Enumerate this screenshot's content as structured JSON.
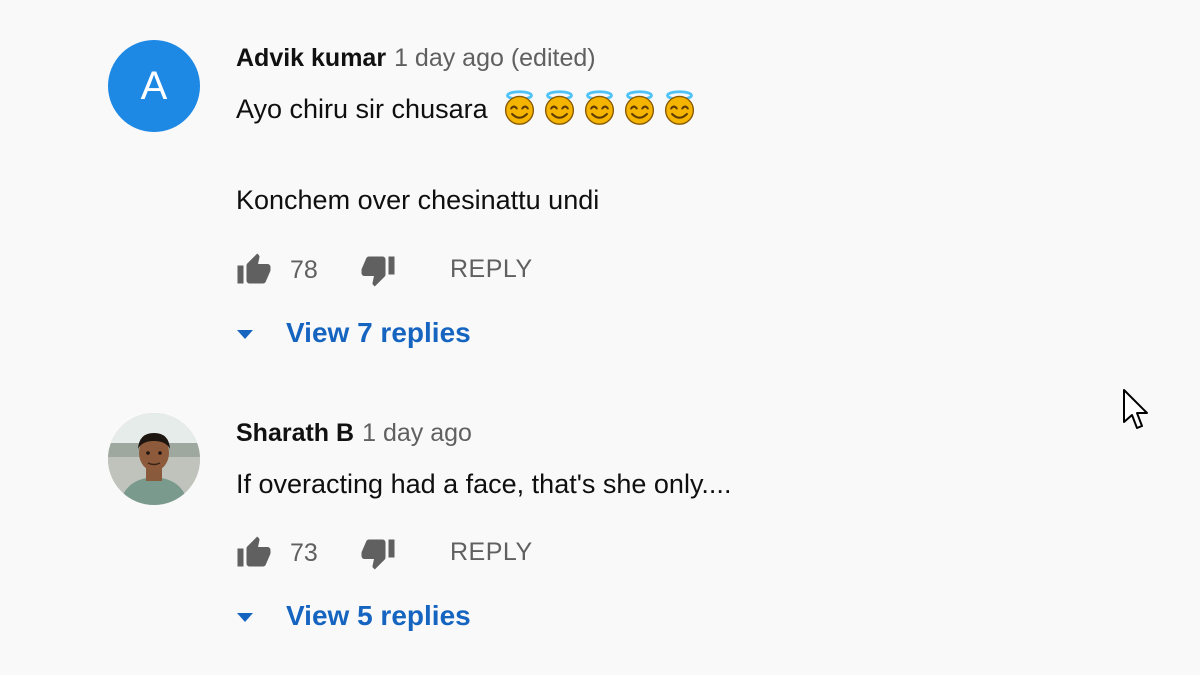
{
  "comments": [
    {
      "author": "Advik kumar",
      "meta": "1 day ago (edited)",
      "avatar_letter": "A",
      "avatar_color": "#1e88e5",
      "text_line1": "Ayo chiru sir chusara",
      "emojis": [
        "smiling-face-with-halo",
        "smiling-face-with-halo",
        "smiling-face-with-halo",
        "smiling-face-with-halo",
        "smiling-face-with-halo"
      ],
      "text_line2": "Konchem over chesinattu undi",
      "likes": "78",
      "reply_label": "REPLY",
      "view_replies": "View 7 replies"
    },
    {
      "author": "Sharath B",
      "meta": "1 day ago",
      "avatar_photo": "profile-photo",
      "text_line1": "If overacting had a face, that's she only....",
      "likes": "73",
      "reply_label": "REPLY",
      "view_replies": "View 5 replies"
    }
  ],
  "colors": {
    "background": "#f9f9f9",
    "accent_blue": "#1565c0",
    "icon_gray": "#606060"
  }
}
